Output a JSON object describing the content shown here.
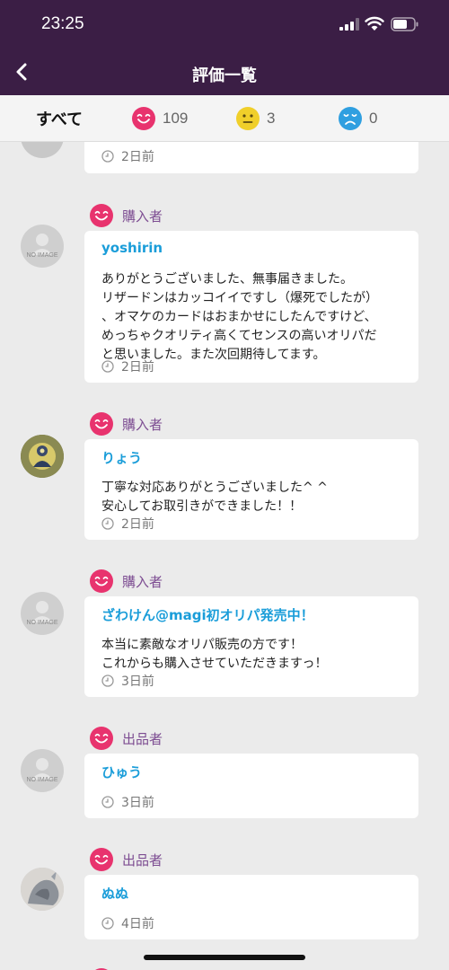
{
  "status_bar": {
    "time": "23:25"
  },
  "nav": {
    "title": "評価一覧"
  },
  "filters": {
    "all_label": "すべて",
    "good_count": "109",
    "neutral_count": "3",
    "bad_count": "0"
  },
  "colors": {
    "header_bg": "#3b1e45",
    "good": "#e8336e",
    "neutral": "#f0cf2a",
    "bad": "#2f9fe0",
    "username": "#1a9dd9",
    "role": "#7d4d92"
  },
  "partial_review": {
    "time": "2日前"
  },
  "reviews": [
    {
      "role": "購入者",
      "avatar": "no-image",
      "avatar_text": "NO IMAGE",
      "name": "yoshirin",
      "body": "ありがとうございました、無事届きました。\nリザードンはカッコイイですし（爆死でしたが）\n、オマケのカードはおまかせにしたんですけど、\nめっちゃクオリティ高くてセンスの高いオリパだ\nと思いました。また次回期待してます。",
      "time": "2日前"
    },
    {
      "role": "購入者",
      "avatar": "photo",
      "name": "りょう",
      "body": "丁寧な対応ありがとうございました^ ^\n安心してお取引きができました！！",
      "time": "2日前"
    },
    {
      "role": "購入者",
      "avatar": "no-image",
      "avatar_text": "NO IMAGE",
      "name": "ざわけん@magi初オリパ発売中！",
      "body": "本当に素敵なオリパ販売の方です！\nこれからも購入させていただきますっ！",
      "time": "3日前"
    },
    {
      "role": "出品者",
      "avatar": "no-image",
      "avatar_text": "NO IMAGE",
      "name": "ひゅう",
      "body": "",
      "time": "3日前"
    },
    {
      "role": "出品者",
      "avatar": "photo",
      "name": "ぬぬ",
      "body": "",
      "time": "4日前"
    }
  ]
}
